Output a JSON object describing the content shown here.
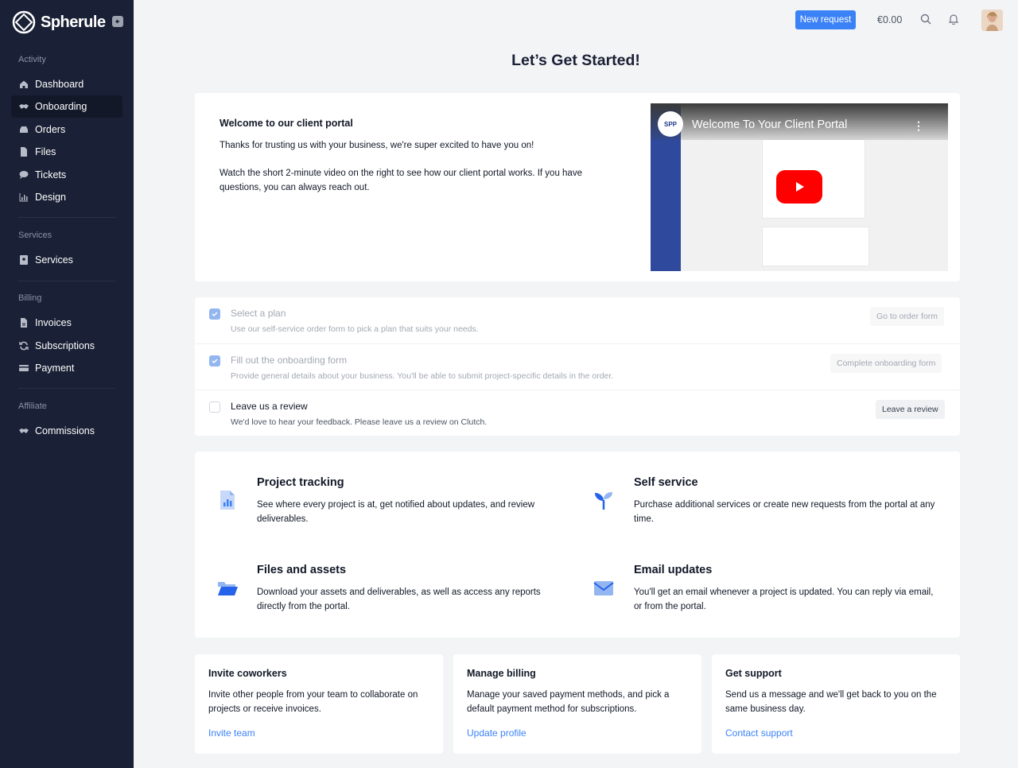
{
  "brand": {
    "name": "Spherule"
  },
  "sidebar": {
    "sections": [
      {
        "title": "Activity"
      },
      {
        "title": "Services"
      },
      {
        "title": "Billing"
      },
      {
        "title": "Affiliate"
      }
    ],
    "items": [
      {
        "label": "Dashboard",
        "icon": "home-icon"
      },
      {
        "label": "Onboarding",
        "icon": "handshake-icon",
        "active": true
      },
      {
        "label": "Orders",
        "icon": "inbox-icon"
      },
      {
        "label": "Files",
        "icon": "file-icon"
      },
      {
        "label": "Tickets",
        "icon": "chat-bubble-icon"
      },
      {
        "label": "Design",
        "icon": "bar-chart-icon"
      },
      {
        "label": "Services",
        "icon": "id-card-icon"
      },
      {
        "label": "Invoices",
        "icon": "file-invoice-icon"
      },
      {
        "label": "Subscriptions",
        "icon": "sync-icon"
      },
      {
        "label": "Payment",
        "icon": "credit-card-icon"
      },
      {
        "label": "Commissions",
        "icon": "handshake-icon"
      }
    ]
  },
  "header": {
    "new_request": "New request",
    "balance": "€0.00"
  },
  "page": {
    "title": "Let’s Get Started!"
  },
  "welcome": {
    "title": "Welcome to our client portal",
    "p1": "Thanks for trusting us with your business, we're super excited to have you on!",
    "p2": "Watch the short 2-minute video on the right to see how our client portal works. If you have questions, you can always reach out.",
    "video": {
      "title": "Welcome To Your Client Portal",
      "badge": "SPP"
    }
  },
  "checklist": [
    {
      "title": "Select a plan",
      "desc": "Use our self-service order form to pick a plan that suits your needs.",
      "button": "Go to order form",
      "done": true
    },
    {
      "title": "Fill out the onboarding form",
      "desc": "Provide general details about your business. You'll be able to submit project-specific details in the order.",
      "button": "Complete onboarding form",
      "done": true
    },
    {
      "title": "Leave us a review",
      "desc": "We'd love to hear your feedback. Please leave us a review on Clutch.",
      "button": "Leave a review",
      "done": false
    }
  ],
  "features": [
    {
      "title": "Project tracking",
      "desc": "See where every project is at, get notified about updates, and review deliverables.",
      "icon": "chart-document-icon"
    },
    {
      "title": "Self service",
      "desc": "Purchase additional services or create new requests from the portal at any time.",
      "icon": "sprout-icon"
    },
    {
      "title": "Files and assets",
      "desc": "Download your assets and deliverables, as well as access any reports directly from the portal.",
      "icon": "folder-open-icon"
    },
    {
      "title": "Email updates",
      "desc": "You'll get an email whenever a project is updated. You can reply via email, or from the portal.",
      "icon": "envelope-icon"
    }
  ],
  "bottom_cards": [
    {
      "title": "Invite coworkers",
      "desc": "Invite other people from your team to collaborate on projects or receive invoices.",
      "link": "Invite team"
    },
    {
      "title": "Manage billing",
      "desc": "Manage your saved payment methods, and pick a default payment method for subscriptions.",
      "link": "Update profile"
    },
    {
      "title": "Get support",
      "desc": "Send us a message and we'll get back to you on the same business day.",
      "link": "Contact support"
    }
  ],
  "colors": {
    "sidebar": "#1a2035",
    "accent": "#3b82f6",
    "background": "#f3f4f6"
  }
}
